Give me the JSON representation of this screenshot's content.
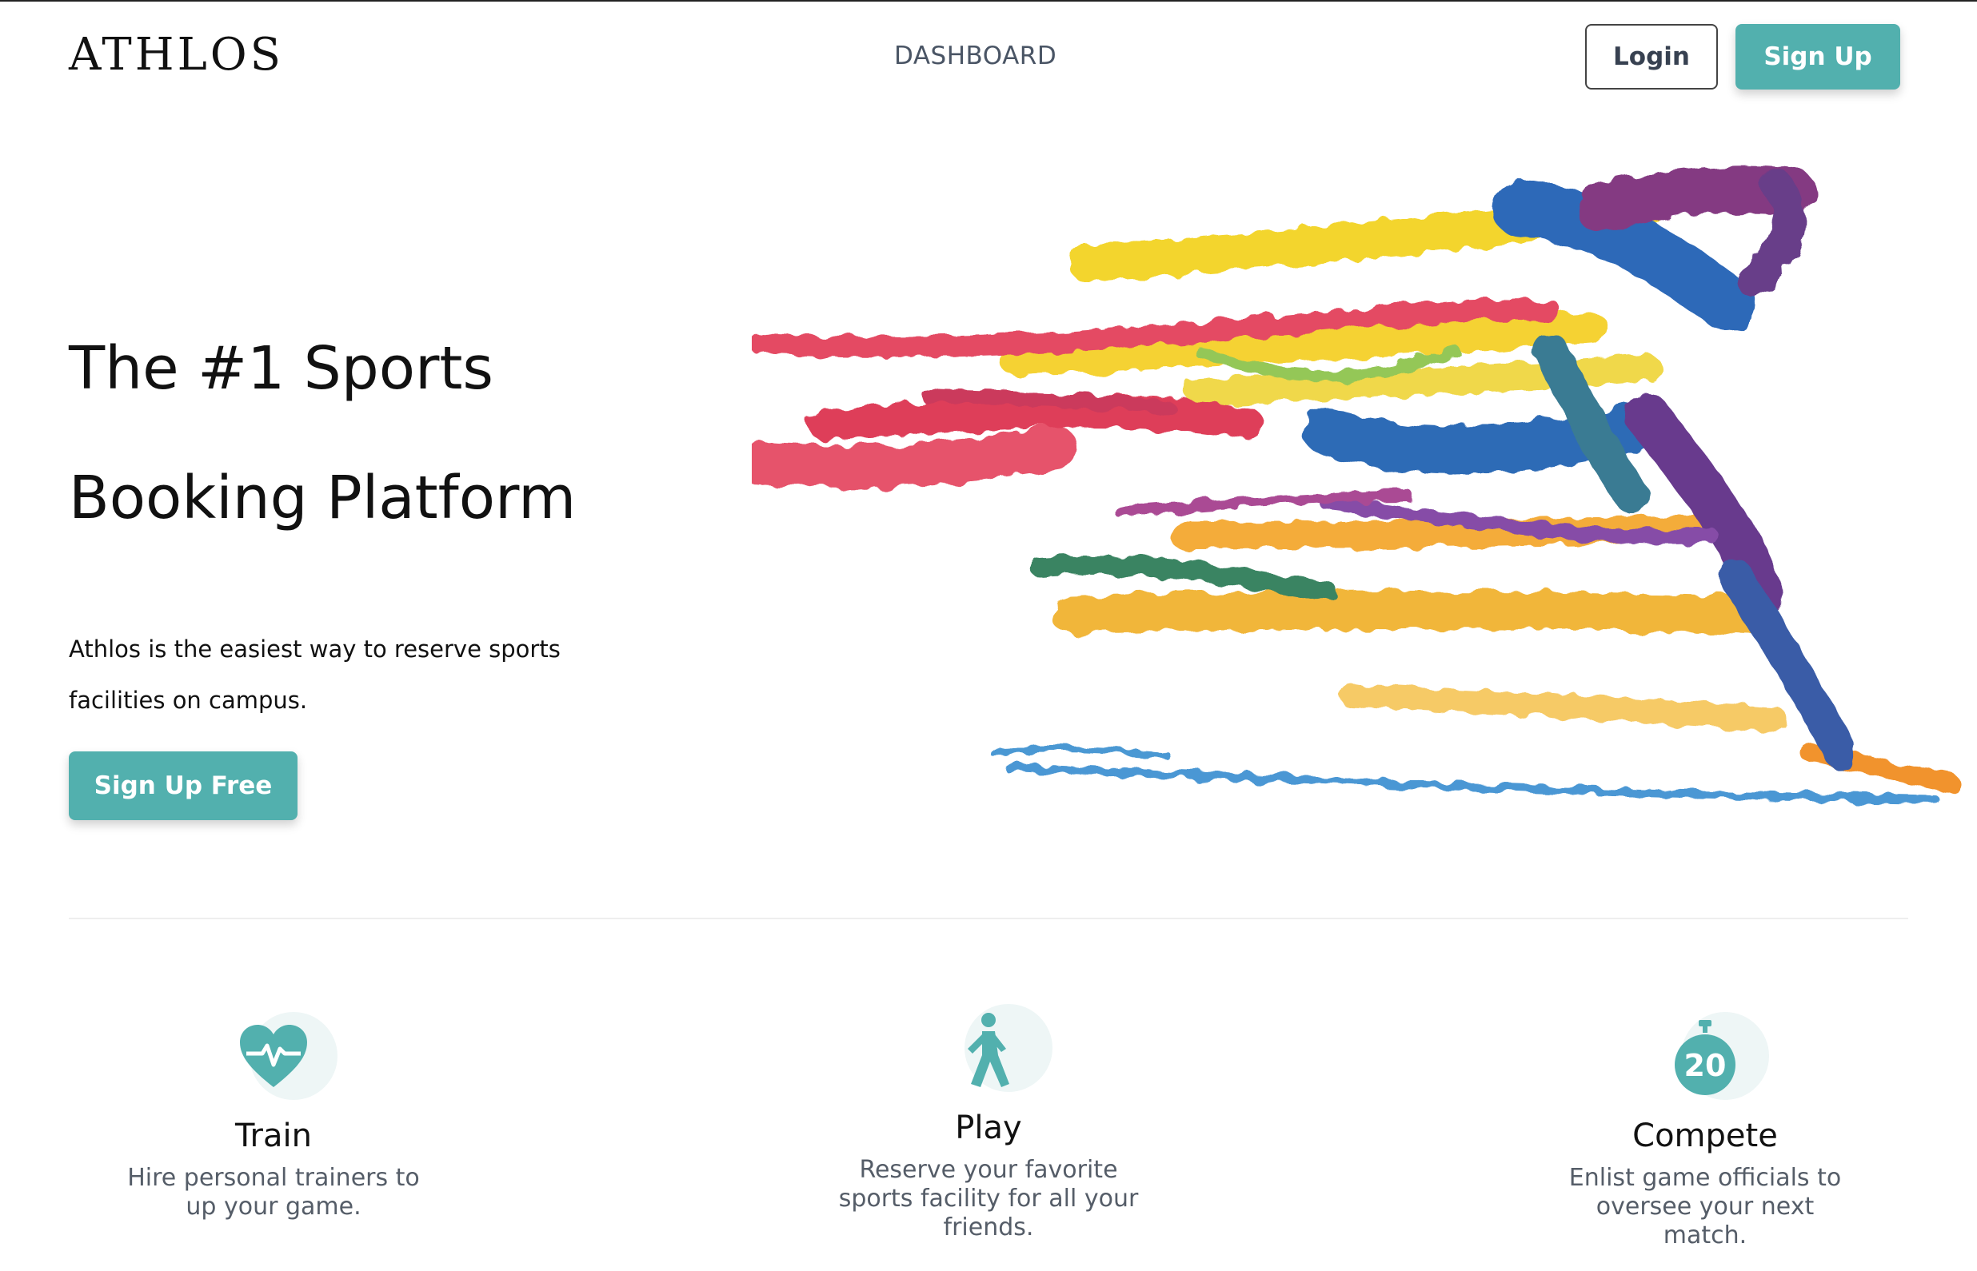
{
  "brand": {
    "logo": "ATHLOS"
  },
  "nav": {
    "dashboard": "DASHBOARD",
    "login": "Login",
    "signup": "Sign Up"
  },
  "hero": {
    "title": "The #1 Sports Booking Platform",
    "subtitle": "Athlos is the easiest way to reserve sports facilities on campus.",
    "cta": "Sign Up Free"
  },
  "features": [
    {
      "icon": "heart-pulse-icon",
      "title": "Train",
      "desc": "Hire personal trainers to up your game."
    },
    {
      "icon": "walking-person-icon",
      "title": "Play",
      "desc": "Reserve your favorite sports facility for all your friends."
    },
    {
      "icon": "stopwatch-20-icon",
      "title": "Compete",
      "desc": "Enlist game officials to oversee your next match."
    }
  ],
  "colors": {
    "accent": "#52b0ae",
    "text": "#111111",
    "muted": "#555d68",
    "nav": "#4a5565"
  }
}
